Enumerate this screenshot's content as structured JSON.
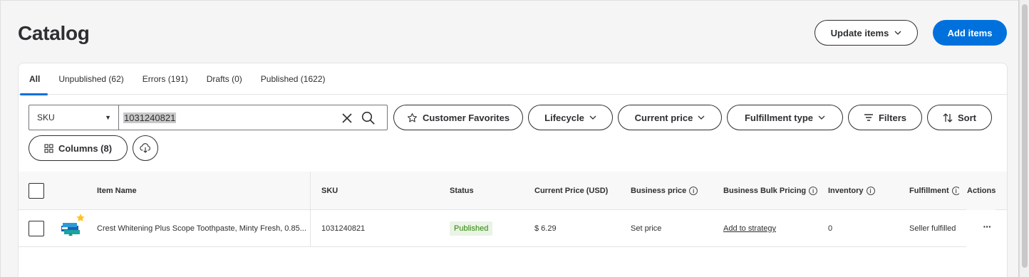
{
  "page": {
    "title": "Catalog"
  },
  "header": {
    "update_items_label": "Update items",
    "add_items_label": "Add items"
  },
  "tabs": [
    {
      "label": "All",
      "active": true
    },
    {
      "label": "Unpublished (62)"
    },
    {
      "label": "Errors (191)"
    },
    {
      "label": "Drafts (0)"
    },
    {
      "label": "Published (1622)"
    }
  ],
  "search": {
    "field_selected": "SKU",
    "value": "1031240821"
  },
  "filters": {
    "customer_favorites": "Customer Favorites",
    "lifecycle": "Lifecycle",
    "current_price": "Current price",
    "fulfillment_type": "Fulfillment type",
    "filters": "Filters",
    "sort": "Sort",
    "columns": "Columns (8)"
  },
  "table": {
    "headers": {
      "item_name": "Item Name",
      "sku": "SKU",
      "status": "Status",
      "current_price": "Current Price (USD)",
      "business_price": "Business price",
      "business_bulk_pricing": "Business Bulk Pricing",
      "inventory": "Inventory",
      "fulfillment": "Fulfillment",
      "actions": "Actions"
    },
    "rows": [
      {
        "item_name": "Crest Whitening Plus Scope Toothpaste, Minty Fresh, 0.85...",
        "sku": "1031240821",
        "status": "Published",
        "current_price": "$ 6.29",
        "business_price": "Set price",
        "business_bulk_pricing": "Add to strategy",
        "inventory": "0",
        "fulfillment": "Seller fulfilled",
        "actions": "···"
      }
    ]
  },
  "colors": {
    "primary": "#0071dc",
    "published_bg": "#eaf3e6",
    "published_text": "#2a8703",
    "favorite_star": "#ffc220"
  },
  "icons": [
    "chevron-down-icon",
    "close-icon",
    "search-icon",
    "star-icon",
    "filter-icon",
    "sort-icon",
    "columns-grid-icon",
    "cloud-download-icon",
    "info-icon",
    "more-horizontal-icon"
  ]
}
